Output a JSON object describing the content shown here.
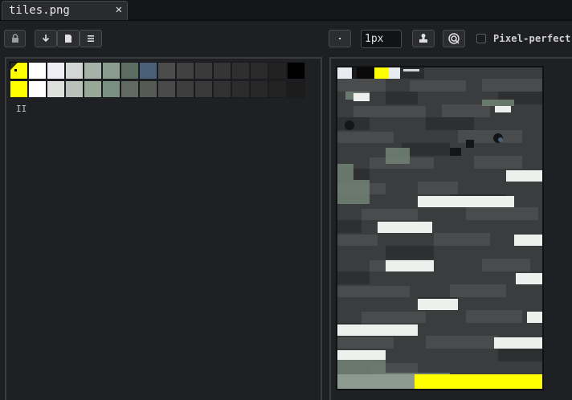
{
  "tab": {
    "title": "tiles.png",
    "close_glyph": "✕"
  },
  "toolbar": {
    "zoom_value": "1px",
    "pixel_perfect_label": "Pixel-perfect",
    "pixel_perfect_checked": false,
    "icons": [
      "lock-icon",
      "download-icon",
      "document-icon",
      "menu-icon",
      "dot-icon",
      "stamp-icon",
      "target-icon"
    ]
  },
  "palette": {
    "row1": [
      "#ffff00",
      "#ffffff",
      "#eeeef4",
      "#d4d6d4",
      "#a6b2a8",
      "#899c8e",
      "#5b6d60",
      "#4a6078",
      "#4c4c4c",
      "#414141",
      "#3a3a3a",
      "#353535",
      "#2f2f2f",
      "#2a2a2a",
      "#222222",
      "#000000"
    ],
    "row2": [
      "#ffff00",
      "#ffffff",
      "#dde0dc",
      "#b9c2b8",
      "#98a898",
      "#7b8f80",
      "#616a62",
      "#555a55",
      "#4a4a4a",
      "#3e3e3e",
      "#393939",
      "#323232",
      "#2c2c2c",
      "#282828",
      "#232323",
      "#1c1c1c"
    ],
    "slot_count": "II"
  },
  "colors": {
    "background": "#1e1f22",
    "panel_border": "#3a3c40",
    "accent_yellow": "#ffff00"
  }
}
